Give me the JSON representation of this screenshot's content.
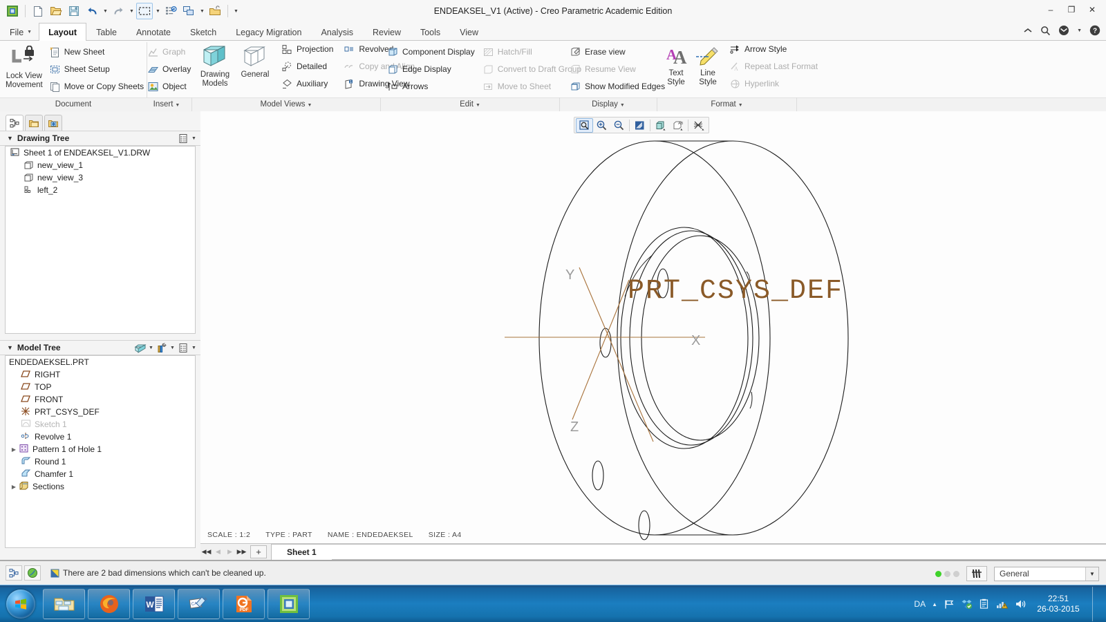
{
  "window": {
    "title": "ENDEAKSEL_V1 (Active) - Creo Parametric Academic Edition",
    "minimize": "–",
    "restore": "❐",
    "close": "✕"
  },
  "quick_access": {
    "items": [
      {
        "name": "creo-app-icon",
        "label": "Creo"
      },
      {
        "name": "new-file-icon",
        "label": "New"
      },
      {
        "name": "open-file-icon",
        "label": "Open"
      },
      {
        "name": "save-icon",
        "label": "Save"
      },
      {
        "name": "undo-icon",
        "label": "Undo"
      },
      {
        "name": "redo-icon",
        "label": "Redo"
      },
      {
        "name": "select-box-icon",
        "label": "Select"
      },
      {
        "name": "regenerate-icon",
        "label": "Regenerate"
      },
      {
        "name": "window-switch-icon",
        "label": "Switch Window"
      },
      {
        "name": "close-window-icon",
        "label": "Close"
      }
    ],
    "overflow_caret": "▼"
  },
  "tabs": {
    "file_label": "File",
    "items": [
      {
        "label": "Layout",
        "active": true
      },
      {
        "label": "Table",
        "active": false
      },
      {
        "label": "Annotate",
        "active": false
      },
      {
        "label": "Sketch",
        "active": false
      },
      {
        "label": "Legacy Migration",
        "active": false
      },
      {
        "label": "Analysis",
        "active": false
      },
      {
        "label": "Review",
        "active": false
      },
      {
        "label": "Tools",
        "active": false
      },
      {
        "label": "View",
        "active": false
      }
    ],
    "right_icons": [
      {
        "name": "collapse-ribbon-icon",
        "glyph": "˄"
      },
      {
        "name": "search-icon",
        "glyph": "⚲"
      },
      {
        "name": "account-icon",
        "glyph": "◔"
      },
      {
        "name": "account-caret-icon",
        "glyph": "▾"
      },
      {
        "name": "help-icon",
        "glyph": "?"
      }
    ]
  },
  "ribbon": {
    "groups": [
      {
        "name": "document",
        "label": "Document",
        "caret": "",
        "big_buttons": [
          {
            "name": "lock-view-movement",
            "label": "Lock View\nMovement",
            "icon": "lock-view-icon",
            "line1": "Lock View",
            "line2": "Movement"
          }
        ],
        "small_buttons": [
          {
            "label": "New Sheet",
            "icon": "new-sheet-icon",
            "disabled": false
          },
          {
            "label": "Sheet Setup",
            "icon": "sheet-setup-icon",
            "disabled": false
          },
          {
            "label": "Move or Copy Sheets",
            "icon": "move-copy-sheets-icon",
            "disabled": false
          }
        ]
      },
      {
        "name": "insert",
        "label": "Insert",
        "caret": "▼",
        "big_buttons": [],
        "small_buttons": [
          {
            "label": "Graph",
            "icon": "graph-icon",
            "disabled": true
          },
          {
            "label": "Overlay",
            "icon": "overlay-icon",
            "disabled": false
          },
          {
            "label": "Object",
            "icon": "object-icon",
            "disabled": false
          }
        ]
      },
      {
        "name": "model-views",
        "label": "Model Views",
        "caret": "▼",
        "big_buttons": [
          {
            "name": "drawing-models",
            "icon": "drawing-models-icon",
            "line1": "Drawing",
            "line2": "Models"
          },
          {
            "name": "general-view",
            "icon": "general-view-icon",
            "line1": "General",
            "line2": ""
          }
        ],
        "small_buttons": [
          {
            "label": "Projection",
            "icon": "projection-icon",
            "disabled": false
          },
          {
            "label": "Detailed",
            "icon": "detailed-icon",
            "disabled": false
          },
          {
            "label": "Auxiliary",
            "icon": "auxiliary-icon",
            "disabled": false
          },
          {
            "label": "Revolved",
            "icon": "revolved-icon",
            "disabled": false
          },
          {
            "label": "Copy and Align",
            "icon": "copy-align-icon",
            "disabled": true
          },
          {
            "label": "Drawing View",
            "icon": "drawing-view-icon",
            "disabled": false
          }
        ]
      },
      {
        "name": "edit",
        "label": "Edit",
        "caret": "▼",
        "big_buttons": [],
        "small_buttons": [
          {
            "label": "Component Display",
            "icon": "component-display-icon",
            "disabled": false
          },
          {
            "label": "Edge Display",
            "icon": "edge-display-icon",
            "disabled": false
          },
          {
            "label": "Arrows",
            "icon": "arrows-icon",
            "disabled": false
          },
          {
            "label": "Hatch/Fill",
            "icon": "hatch-fill-icon",
            "disabled": true
          },
          {
            "label": "Convert to Draft Group",
            "icon": "convert-draft-group-icon",
            "disabled": true
          },
          {
            "label": "Move to Sheet",
            "icon": "move-to-sheet-icon",
            "disabled": true
          }
        ]
      },
      {
        "name": "display",
        "label": "Display",
        "caret": "▼",
        "big_buttons": [],
        "small_buttons": [
          {
            "label": "Erase view",
            "icon": "erase-view-icon",
            "disabled": false
          },
          {
            "label": "Resume View",
            "icon": "resume-view-icon",
            "disabled": true
          },
          {
            "label": "Show Modified Edges",
            "icon": "show-modified-edges-icon",
            "disabled": false
          }
        ]
      },
      {
        "name": "format",
        "label": "Format",
        "caret": "▼",
        "big_buttons": [
          {
            "name": "text-style",
            "icon": "text-style-icon",
            "line1": "Text",
            "line2": "Style"
          },
          {
            "name": "line-style",
            "icon": "line-style-icon",
            "line1": "Line",
            "line2": "Style"
          }
        ],
        "small_buttons": [
          {
            "label": "Arrow Style",
            "icon": "arrow-style-icon",
            "disabled": false
          },
          {
            "label": "Repeat Last Format",
            "icon": "repeat-last-format-icon",
            "disabled": true
          },
          {
            "label": "Hyperlink",
            "icon": "hyperlink-icon",
            "disabled": true
          }
        ]
      }
    ]
  },
  "navigator": {
    "tabs": [
      {
        "name": "model-tree-tab",
        "active": true
      },
      {
        "name": "folder-browser-tab",
        "active": false
      },
      {
        "name": "favorites-tab",
        "active": false
      }
    ],
    "drawing_tree": {
      "title": "Drawing Tree",
      "collapse_glyph": "▼",
      "settings_caret": "▼",
      "rows": [
        {
          "label": "Sheet 1 of ENDEAKSEL_V1.DRW",
          "icon": "sheet-icon",
          "indent": 0,
          "expander": "",
          "dim": false
        },
        {
          "label": "new_view_1",
          "icon": "view-icon",
          "indent": 1,
          "expander": "",
          "dim": false
        },
        {
          "label": "new_view_3",
          "icon": "view-icon",
          "indent": 1,
          "expander": "",
          "dim": false
        },
        {
          "label": "left_2",
          "icon": "projection-view-icon",
          "indent": 1,
          "expander": "",
          "dim": false
        }
      ]
    },
    "model_tree": {
      "title": "Model Tree",
      "collapse_glyph": "▼",
      "header_icons": [
        {
          "name": "model-tree-filter-icon",
          "caret": "▼"
        },
        {
          "name": "model-tree-tools-icon",
          "caret": "▼"
        },
        {
          "name": "model-tree-settings-icon",
          "caret": "▼"
        }
      ],
      "rows": [
        {
          "label": "ENDEDAEKSEL.PRT",
          "icon": "part-icon",
          "indent": 0,
          "expander": "",
          "dim": false
        },
        {
          "label": "RIGHT",
          "icon": "datum-plane-icon",
          "indent": 1,
          "expander": "",
          "dim": false
        },
        {
          "label": "TOP",
          "icon": "datum-plane-icon",
          "indent": 1,
          "expander": "",
          "dim": false
        },
        {
          "label": "FRONT",
          "icon": "datum-plane-icon",
          "indent": 1,
          "expander": "",
          "dim": false
        },
        {
          "label": "PRT_CSYS_DEF",
          "icon": "csys-icon",
          "indent": 1,
          "expander": "",
          "dim": false
        },
        {
          "label": "Sketch 1",
          "icon": "sketch-icon",
          "indent": 1,
          "expander": "",
          "dim": true
        },
        {
          "label": "Revolve 1",
          "icon": "revolve-icon",
          "indent": 1,
          "expander": "",
          "dim": false
        },
        {
          "label": "Pattern 1 of Hole 1",
          "icon": "pattern-icon",
          "indent": 1,
          "expander": "▶",
          "dim": false
        },
        {
          "label": "Round 1",
          "icon": "round-icon",
          "indent": 1,
          "expander": "",
          "dim": false
        },
        {
          "label": "Chamfer 1",
          "icon": "chamfer-icon",
          "indent": 1,
          "expander": "",
          "dim": false
        },
        {
          "label": "Sections",
          "icon": "sections-icon",
          "indent": 1,
          "expander": "▶",
          "dim": false
        }
      ]
    }
  },
  "graphics_toolbar": {
    "buttons": [
      {
        "name": "refit-icon",
        "selected": true
      },
      {
        "name": "zoom-in-icon",
        "selected": false
      },
      {
        "name": "zoom-out-icon",
        "selected": false
      },
      {
        "name": "repaint-icon",
        "selected": false
      },
      {
        "name": "display-style-icon",
        "selected": false,
        "caret": true
      },
      {
        "name": "annotation-display-icon",
        "selected": false,
        "caret": true
      },
      {
        "name": "datum-display-icon",
        "selected": false,
        "caret": true
      }
    ]
  },
  "drawing": {
    "csys_label": "PRT_CSYS_DEF",
    "csys_label_color": "#8a5a28",
    "axis_labels": {
      "x": "X",
      "y": "Y",
      "z": "Z"
    },
    "sheet_note": [
      "SCALE : 1:2",
      "TYPE : PART",
      "NAME : ENDEDAEKSEL",
      "SIZE : A4"
    ]
  },
  "sheet_bar": {
    "nav": [
      {
        "name": "first-sheet-button",
        "glyph": "◀◀",
        "disabled": false
      },
      {
        "name": "prev-sheet-button",
        "glyph": "◀",
        "disabled": true
      },
      {
        "name": "next-sheet-button",
        "glyph": "▶",
        "disabled": true
      },
      {
        "name": "last-sheet-button",
        "glyph": "▶▶",
        "disabled": false
      }
    ],
    "add_label": "+",
    "tabs": [
      {
        "label": "Sheet 1",
        "active": true
      }
    ]
  },
  "status_bar": {
    "message": "There are 2 bad dimensions which can't be cleaned up.",
    "message_icon": "warning-flag-icon",
    "left_icons": [
      {
        "name": "model-tree-toggle-icon"
      },
      {
        "name": "browser-toggle-icon"
      }
    ],
    "selection_dots": [
      true,
      false,
      false
    ],
    "glass_icon": "selection-filter-icon",
    "filter_value": "General",
    "filter_caret": "▼"
  },
  "taskbar": {
    "start_label": "Start",
    "buttons": [
      {
        "name": "explorer-taskbar-button",
        "label": "Windows Explorer"
      },
      {
        "name": "firefox-taskbar-button",
        "label": "Mozilla Firefox"
      },
      {
        "name": "word-taskbar-button",
        "label": "Microsoft Word"
      },
      {
        "name": "cas-taskbar-button",
        "label": "CAS"
      },
      {
        "name": "pdf-taskbar-button",
        "label": "PDF Reader"
      },
      {
        "name": "creo-taskbar-button",
        "label": "Creo Parametric"
      }
    ],
    "tray": {
      "language": "DA",
      "show_hidden_glyph": "▲",
      "icons": [
        {
          "name": "action-flag-icon"
        },
        {
          "name": "dropbox-icon"
        },
        {
          "name": "network-clipboard-icon"
        },
        {
          "name": "network-warning-icon"
        },
        {
          "name": "volume-icon"
        }
      ],
      "time": "22:51",
      "date": "26-03-2015"
    }
  }
}
